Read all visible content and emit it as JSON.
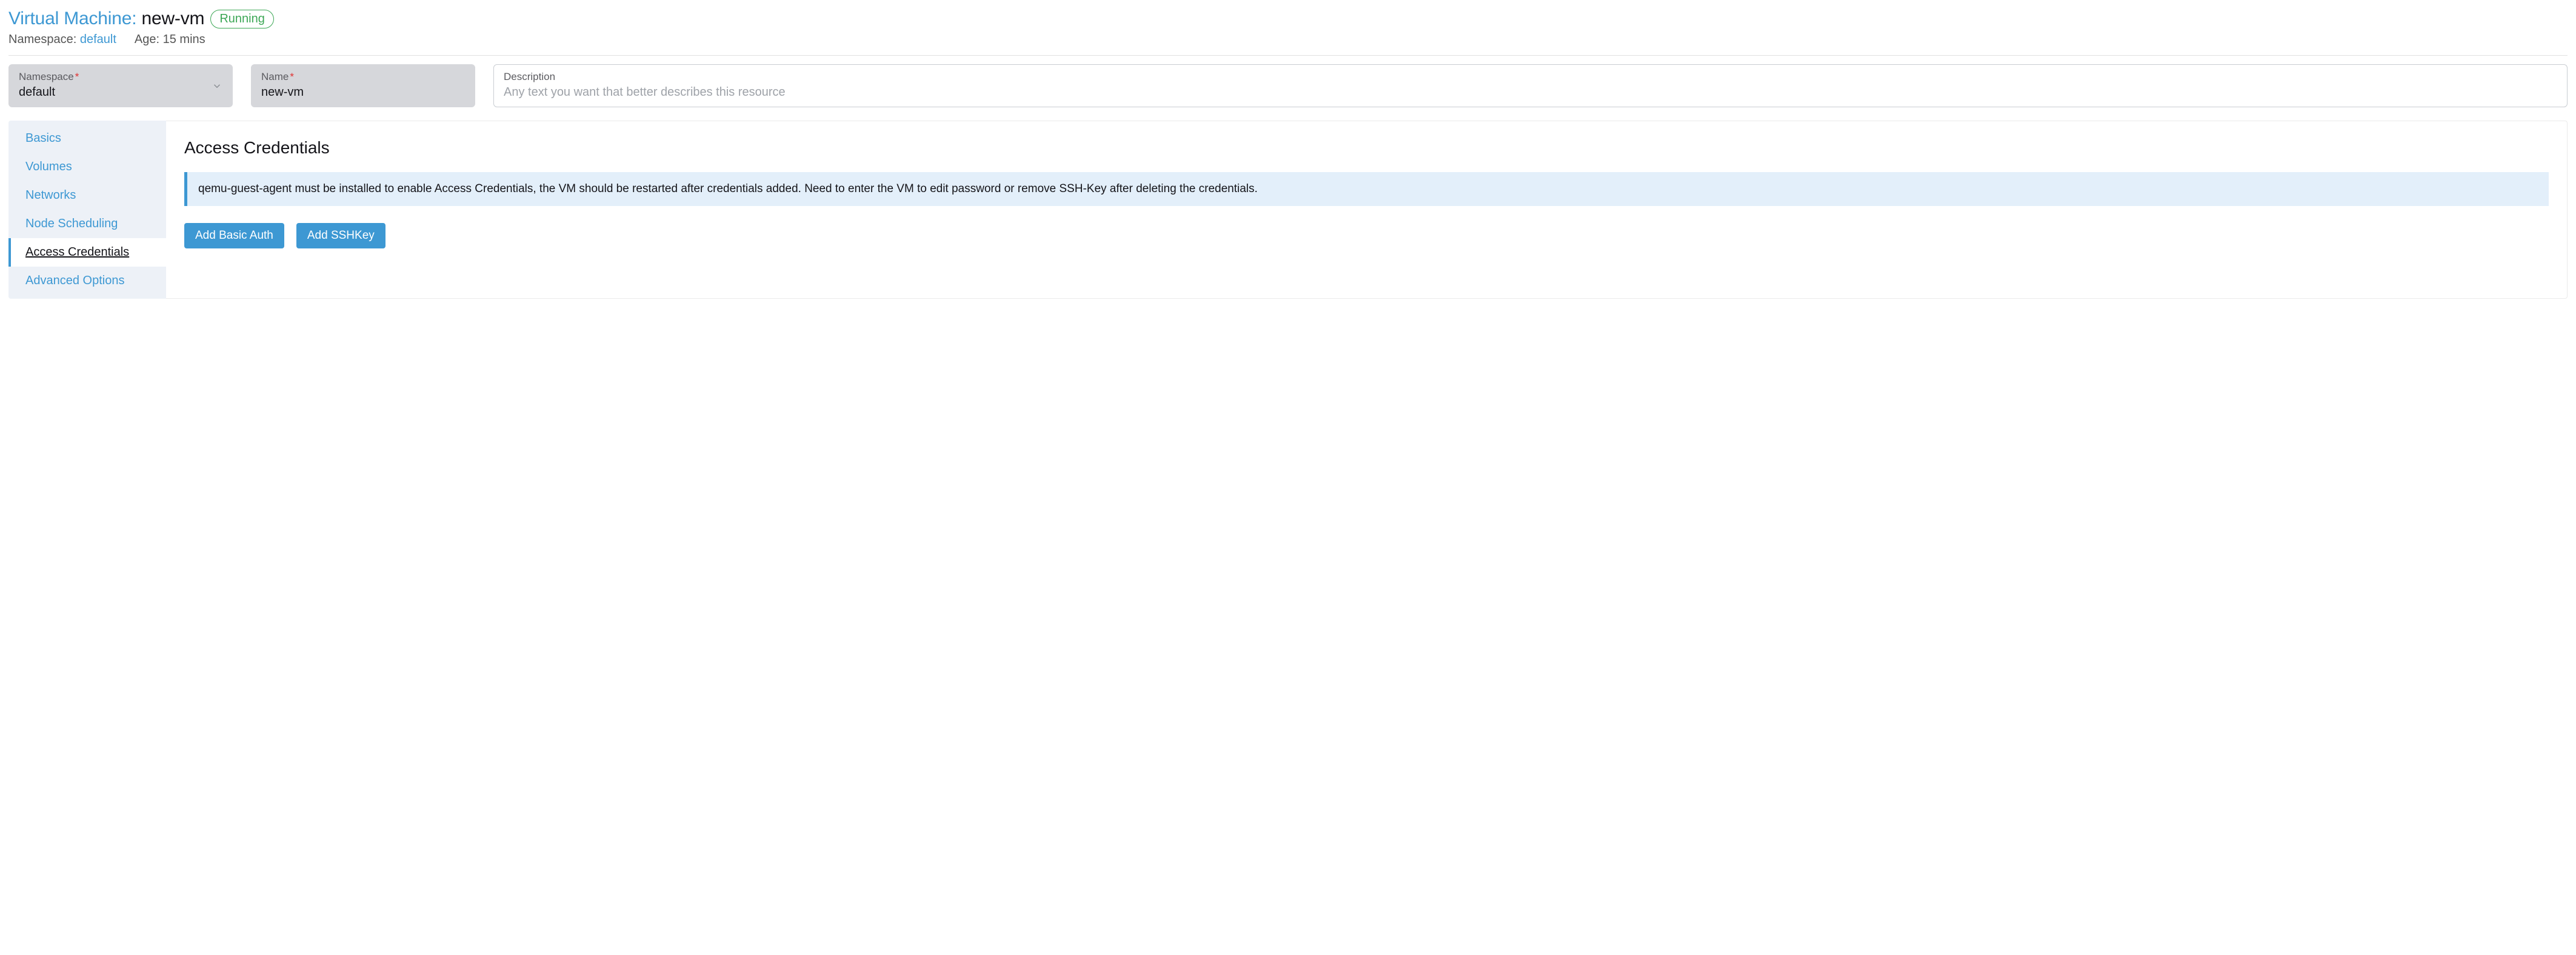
{
  "header": {
    "type_label": "Virtual Machine:",
    "name": "new-vm",
    "status": "Running",
    "namespace_label": "Namespace:",
    "namespace_value": "default",
    "age_label": "Age:",
    "age_value": "15 mins"
  },
  "fields": {
    "namespace": {
      "label": "Namespace",
      "required": "*",
      "value": "default"
    },
    "name": {
      "label": "Name",
      "required": "*",
      "value": "new-vm"
    },
    "description": {
      "label": "Description",
      "placeholder": "Any text you want that better describes this resource"
    }
  },
  "tabs": [
    {
      "label": "Basics"
    },
    {
      "label": "Volumes"
    },
    {
      "label": "Networks"
    },
    {
      "label": "Node Scheduling"
    },
    {
      "label": "Access Credentials"
    },
    {
      "label": "Advanced Options"
    }
  ],
  "panel": {
    "title": "Access Credentials",
    "info": "qemu-guest-agent must be installed to enable Access Credentials, the VM should be restarted after credentials added. Need to enter the VM to edit password or remove SSH-Key after deleting the credentials.",
    "add_basic_auth_label": "Add Basic Auth",
    "add_sshkey_label": "Add SSHKey"
  },
  "colors": {
    "accent": "#3d98d3",
    "status_green": "#3ca755"
  }
}
